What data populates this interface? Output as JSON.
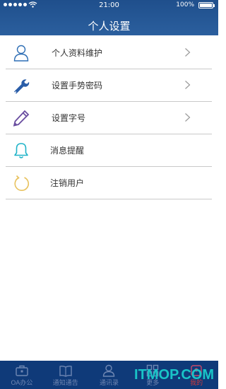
{
  "status_bar": {
    "time": "21:00",
    "battery": "100%"
  },
  "header": {
    "title": "个人设置"
  },
  "menu": {
    "items": [
      {
        "label": "个人资料维护",
        "icon": "user-icon",
        "has_chevron": true
      },
      {
        "label": "设置手势密码",
        "icon": "wrench-icon",
        "has_chevron": true
      },
      {
        "label": "设置字号",
        "icon": "pencil-icon",
        "has_chevron": true
      },
      {
        "label": "消息提醒",
        "icon": "bell-icon",
        "has_chevron": false
      },
      {
        "label": "注销用户",
        "icon": "logout-icon",
        "has_chevron": false
      }
    ]
  },
  "tabbar": {
    "tabs": [
      {
        "label": "OA办公",
        "icon": "briefcase-icon"
      },
      {
        "label": "通知通告",
        "icon": "book-icon"
      },
      {
        "label": "通讯录",
        "icon": "contacts-icon"
      },
      {
        "label": "更多",
        "icon": "grid-icon"
      },
      {
        "label": "我的",
        "icon": "profile-icon",
        "active": true
      }
    ]
  },
  "watermark": {
    "text": "ITMOP.COM"
  },
  "colors": {
    "header": "#2b5f9e",
    "tabbar": "#0f3a79",
    "active_tab": "#d03a3a",
    "watermark": "#19c4c7"
  }
}
